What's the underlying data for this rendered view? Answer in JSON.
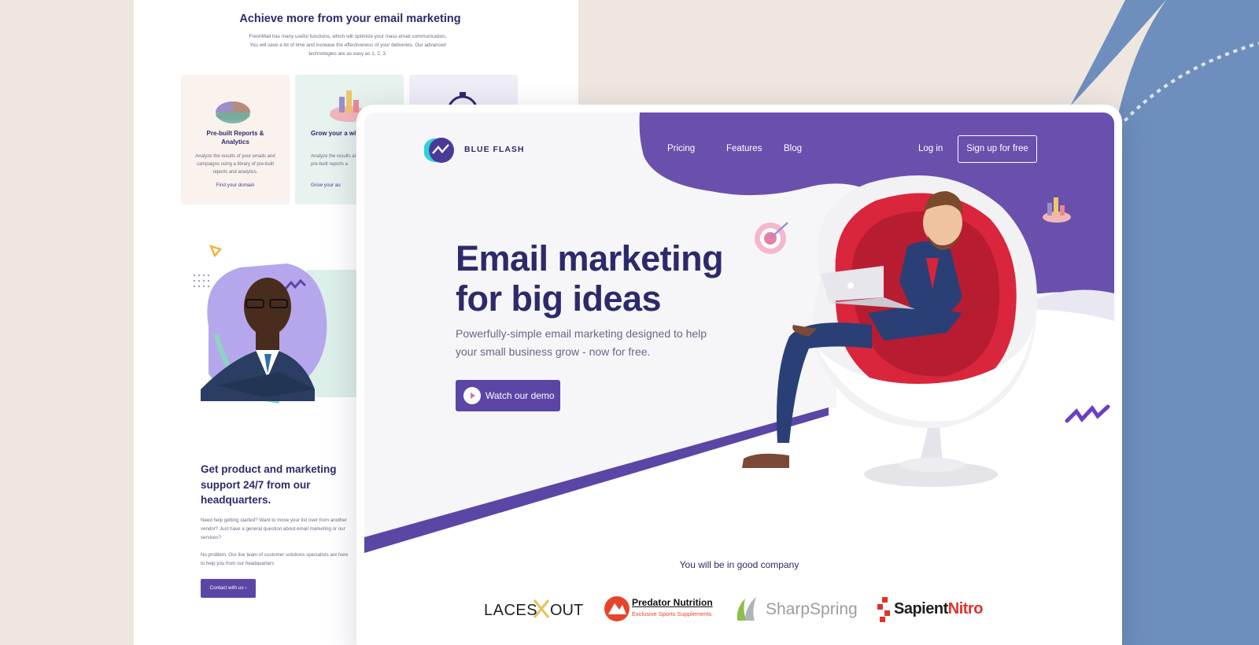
{
  "colors": {
    "background": "#efe7df",
    "blue_panel": "#6e8fbd",
    "purple": "#5b46a6",
    "navy": "#2d2a6b"
  },
  "back_page": {
    "title": "Achieve more from your email marketing",
    "description": "FreshMail has many useful functions, which will optimize your mass email communication. You will save a lot of time and increase the effectiveness of your deliveries. Our advanced technologies are as easy as 1, 2, 3.",
    "cards": [
      {
        "icon": "pie-chart-icon",
        "title": "Pre-built Reports & Analytics",
        "text": "Analyze the results of your emails and campaigns using a library of pre-built reports and analytics.",
        "link": "Find your domain"
      },
      {
        "icon": "bar-chart-icon",
        "title": "Grow your a with signup",
        "text": "Analyze the results and campaigns usi pre-built reports a",
        "link": "Grow your au"
      },
      {
        "icon": "stopwatch-icon",
        "title": "",
        "text": "",
        "link": ""
      }
    ],
    "support_title": "Get product and marketing support 24/7 from our headquarters.",
    "support_text_1": "Need help getting started? Want to move your list over from another vendor? Just have a general question about email marketing or our services?",
    "support_text_2": "No problem. Our live team of customer solutions specialists are here to help you from our headquarters",
    "contact_button": "Contact with us"
  },
  "front_page": {
    "logo_text": "BLUE FLASH",
    "nav": {
      "pricing": "Pricing",
      "features": "Features",
      "blog": "Blog",
      "login": "Log in",
      "signup": "Sign up for free"
    },
    "hero": {
      "title_line1": "Email marketing",
      "title_line2": "for big ideas",
      "subtitle": "Powerfully-simple email marketing designed to help your small business grow - now for free.",
      "demo_button": "Watch our demo"
    },
    "company_label": "You will be in good company",
    "brands": [
      {
        "name": "LACESXOUT",
        "part1": "LACES",
        "part2": "OUT"
      },
      {
        "name": "Predator Nutrition",
        "tagline": "Exclusive Sports Supplements"
      },
      {
        "name": "SharpSpring"
      },
      {
        "name": "SapientNitro",
        "part1": "Sapient",
        "part2": "Nitro"
      }
    ]
  }
}
